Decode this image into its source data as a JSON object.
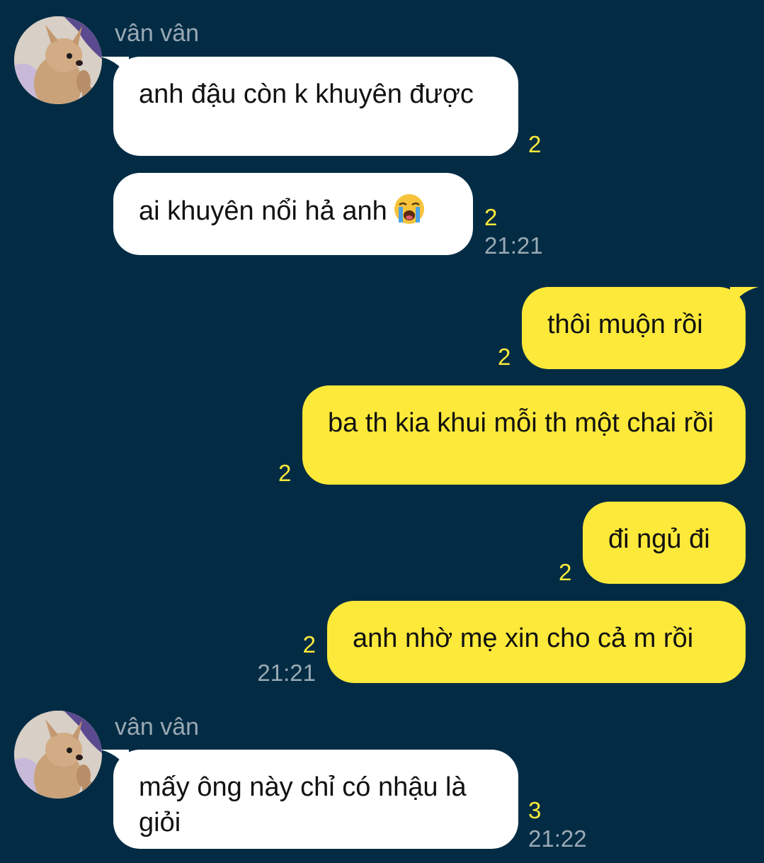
{
  "colors": {
    "background": "#032c44",
    "incoming_bubble": "#ffffff",
    "outgoing_bubble": "#fde93a",
    "unread_count": "#fde93a",
    "timestamp": "#9aa9b4"
  },
  "groups": [
    {
      "sender": "vân vân",
      "avatar": "chihuahua-avatar",
      "messages": [
        {
          "text": "anh đậu còn k khuyên được",
          "unread": "2",
          "time": ""
        },
        {
          "text": "ai khuyên nổi hả anh",
          "emoji": "loudly-crying-face-icon",
          "unread": "2",
          "time": "21:21"
        }
      ]
    },
    {
      "sender": "",
      "outgoing": true,
      "messages": [
        {
          "text": "thôi muộn rồi",
          "unread": "2",
          "time": ""
        },
        {
          "text": "ba th kia khui mỗi th một chai rồi",
          "unread": "2",
          "time": ""
        },
        {
          "text": "đi ngủ đi",
          "unread": "2",
          "time": ""
        },
        {
          "text": "anh nhờ mẹ xin cho cả m rồi",
          "unread": "2",
          "time": "21:21"
        }
      ]
    },
    {
      "sender": "vân vân",
      "avatar": "chihuahua-avatar",
      "messages": [
        {
          "text": "mấy ông này chỉ có nhậu là giỏi",
          "unread": "3",
          "time": "21:22"
        }
      ]
    }
  ]
}
